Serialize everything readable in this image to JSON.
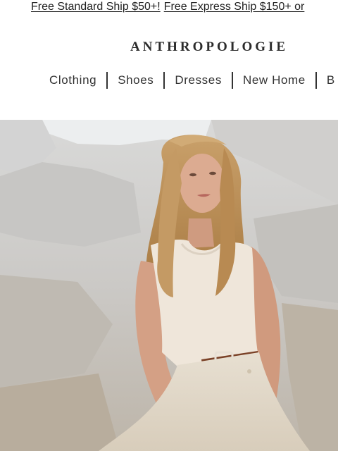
{
  "promo": {
    "standard": "Free Standard Ship $50+!",
    "express": "Free Express Ship $150+ or"
  },
  "header": {
    "logo": "ANTHROPOLOGIE"
  },
  "nav": {
    "items": [
      {
        "label": "Clothing"
      },
      {
        "label": "Shoes"
      },
      {
        "label": "Dresses"
      },
      {
        "label": "New Home"
      },
      {
        "label": "B"
      }
    ]
  },
  "hero": {
    "image": "model-in-white-tank-and-cream-pants-seated-on-rocks",
    "colors": {
      "sky": "#e8e9ea",
      "rock": "#c9c8c6",
      "tank": "#efe6da",
      "pants": "#e4dccd",
      "hair": "#b88a52",
      "skin": "#d7a58b",
      "belt": "#7a4127"
    }
  }
}
